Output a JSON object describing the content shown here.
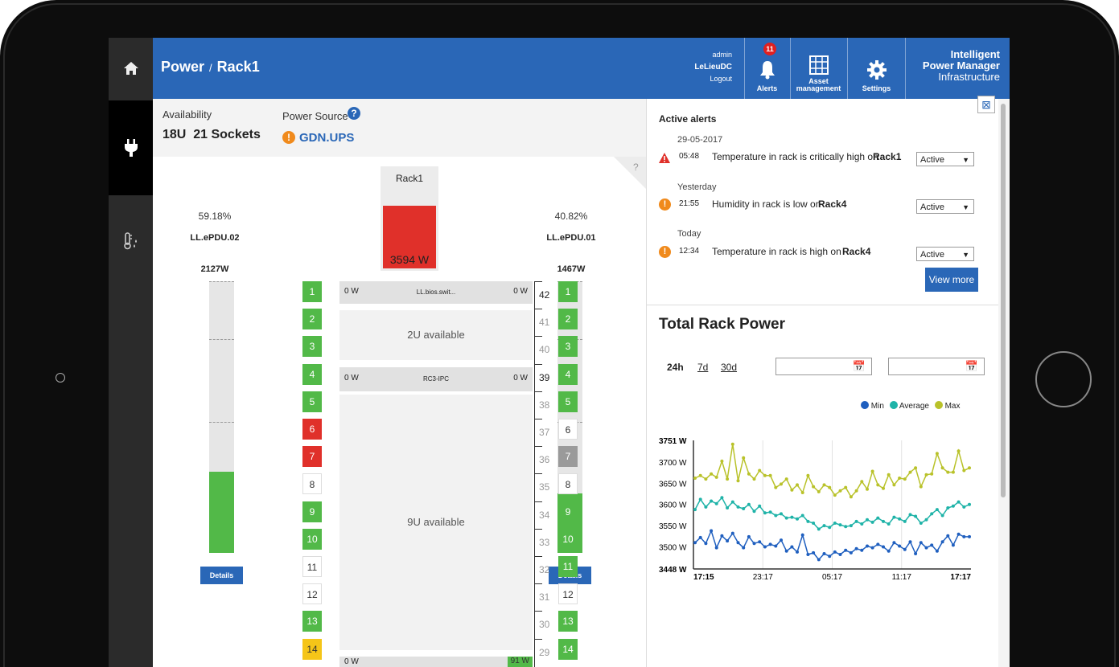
{
  "header": {
    "title": "Power",
    "separator": "/",
    "subtitle": "Rack1",
    "user": {
      "name": "admin",
      "site": "LeLieuDC",
      "logout": "Logout"
    },
    "alerts": {
      "label": "Alerts",
      "count": "11"
    },
    "asset_line1": "Asset",
    "asset_line2": "management",
    "settings": "Settings",
    "product": [
      "Intelligent",
      "Power Manager",
      "Infrastructure"
    ]
  },
  "info": {
    "availability_label": "Availability",
    "availability_value": "18U  21 Sockets",
    "power_source_label": "Power Source",
    "power_source_value": "GDN.UPS",
    "help": "?"
  },
  "rack": {
    "name": "Rack1",
    "power": "3594 W",
    "power_fraction": 0.85,
    "corner_help": "?",
    "left_pdu": {
      "percent": "59.18%",
      "name": "LL.ePDU.02",
      "power": "2127W",
      "fill": 0.3,
      "details": "Details"
    },
    "right_pdu": {
      "percent": "40.82%",
      "name": "LL.ePDU.01",
      "power": "1467W",
      "fill": 0.22,
      "details": "Details"
    },
    "left_sockets": [
      {
        "n": "1",
        "c": "green"
      },
      {
        "n": "2",
        "c": "green"
      },
      {
        "n": "3",
        "c": "green"
      },
      {
        "n": "4",
        "c": "green"
      },
      {
        "n": "5",
        "c": "green"
      },
      {
        "n": "6",
        "c": "red"
      },
      {
        "n": "7",
        "c": "red"
      },
      {
        "n": "8",
        "c": "white"
      },
      {
        "n": "9",
        "c": "green"
      },
      {
        "n": "10",
        "c": "green"
      },
      {
        "n": "11",
        "c": "white"
      },
      {
        "n": "12",
        "c": "white"
      },
      {
        "n": "13",
        "c": "green"
      },
      {
        "n": "14",
        "c": "yellow"
      }
    ],
    "right_sockets": [
      {
        "n": "1",
        "c": "green"
      },
      {
        "n": "2",
        "c": "green"
      },
      {
        "n": "3",
        "c": "green"
      },
      {
        "n": "4",
        "c": "green"
      },
      {
        "n": "5",
        "c": "green"
      },
      {
        "n": "6",
        "c": "white"
      },
      {
        "n": "7",
        "c": "gray"
      },
      {
        "n": "8",
        "c": "white"
      },
      {
        "n": "9",
        "c": "green"
      },
      {
        "n": "10",
        "c": "green"
      },
      {
        "n": "11",
        "c": "green"
      },
      {
        "n": "12",
        "c": "white"
      },
      {
        "n": "13",
        "c": "green"
      },
      {
        "n": "14",
        "c": "green"
      }
    ],
    "units": [
      "42",
      "41",
      "40",
      "39",
      "38",
      "37",
      "36",
      "35",
      "34",
      "33",
      "32",
      "31",
      "30",
      "29"
    ],
    "devices": [
      {
        "left": "0 W",
        "name": "LL.bios.swit...",
        "right": "0 W"
      },
      {
        "left": "0 W",
        "name": "RC3-IPC",
        "right": "0 W"
      },
      {
        "left": "0 W",
        "name": "...",
        "right": "91 W"
      }
    ],
    "empty": [
      "2U available",
      "9U available"
    ]
  },
  "alerts": {
    "title": "Active alerts",
    "groups": [
      {
        "date": "29-05-2017",
        "time": "05:48",
        "text": "Temperature in rack is critically high on ",
        "target": "Rack1",
        "status": "Active",
        "severity": "critical"
      },
      {
        "date": "Yesterday",
        "time": "21:55",
        "text": "Humidity in rack is low on ",
        "target": "Rack4",
        "status": "Active",
        "severity": "warning"
      },
      {
        "date": "Today",
        "time": "12:34",
        "text": "Temperature in rack is high on ",
        "target": "Rack4",
        "status": "Active",
        "severity": "warning"
      }
    ],
    "view_more": "View more"
  },
  "power_chart": {
    "title": "Total Rack Power",
    "ranges": [
      "24h",
      "7d",
      "30d"
    ],
    "legend": [
      "Min",
      "Average",
      "Max"
    ],
    "colors": {
      "min": "#1f5fbf",
      "avg": "#1fb3a8",
      "max": "#b9c22a"
    }
  },
  "chart_data": {
    "type": "line",
    "title": "Total Rack Power",
    "x_ticks": [
      "17:15",
      "23:17",
      "05:17",
      "11:17",
      "17:17"
    ],
    "y_ticks": [
      "3751 W",
      "3700 W",
      "3650 W",
      "3600 W",
      "3550 W",
      "3500 W",
      "3448 W"
    ],
    "ylim": [
      3448,
      3751
    ],
    "series": [
      {
        "name": "Max",
        "values": [
          3662,
          3668,
          3660,
          3672,
          3664,
          3702,
          3660,
          3742,
          3656,
          3710,
          3672,
          3660,
          3680,
          3668,
          3668,
          3640,
          3648,
          3660,
          3634,
          3646,
          3628,
          3668,
          3642,
          3630,
          3646,
          3640,
          3622,
          3632,
          3640,
          3618,
          3632,
          3654,
          3636,
          3678,
          3646,
          3638,
          3670,
          3646,
          3662,
          3660,
          3676,
          3686,
          3642,
          3670,
          3672,
          3720,
          3686,
          3676,
          3676,
          3726,
          3680,
          3686
        ]
      },
      {
        "name": "Average",
        "values": [
          3588,
          3612,
          3594,
          3608,
          3602,
          3616,
          3592,
          3606,
          3594,
          3590,
          3600,
          3584,
          3596,
          3580,
          3582,
          3574,
          3578,
          3568,
          3570,
          3566,
          3574,
          3560,
          3556,
          3542,
          3550,
          3546,
          3556,
          3552,
          3548,
          3550,
          3560,
          3554,
          3564,
          3558,
          3568,
          3560,
          3554,
          3570,
          3566,
          3560,
          3576,
          3572,
          3556,
          3564,
          3578,
          3588,
          3574,
          3592,
          3596,
          3606,
          3594,
          3600
        ]
      },
      {
        "name": "Min",
        "values": [
          3510,
          3522,
          3508,
          3538,
          3498,
          3526,
          3514,
          3532,
          3510,
          3498,
          3524,
          3508,
          3512,
          3500,
          3506,
          3502,
          3516,
          3490,
          3500,
          3488,
          3528,
          3482,
          3486,
          3470,
          3484,
          3478,
          3488,
          3482,
          3492,
          3486,
          3496,
          3492,
          3502,
          3498,
          3506,
          3500,
          3490,
          3510,
          3502,
          3494,
          3512,
          3484,
          3510,
          3498,
          3504,
          3490,
          3512,
          3526,
          3504,
          3530,
          3524,
          3524
        ]
      }
    ]
  }
}
